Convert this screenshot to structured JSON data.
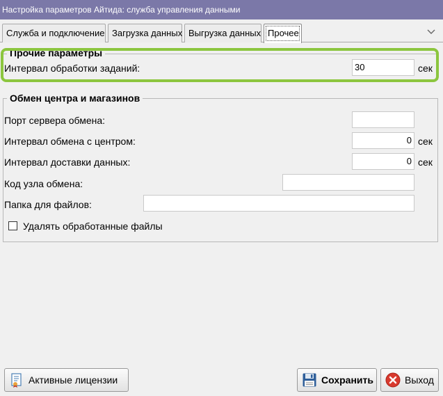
{
  "window": {
    "title": "Настройка параметров Айтида: служба управления данными"
  },
  "tabs": [
    {
      "label": "Служба и подключение",
      "active": false
    },
    {
      "label": "Загрузка данных",
      "active": false
    },
    {
      "label": "Выгрузка данных",
      "active": false
    },
    {
      "label": "Прочее",
      "active": true
    }
  ],
  "other_params": {
    "title": "Прочие параметры",
    "task_interval_label": "Интервал обработки заданий:",
    "task_interval_value": "30",
    "task_interval_unit": "сек"
  },
  "exchange": {
    "title": "Обмен центра и магазинов",
    "server_port_label": "Порт сервера обмена:",
    "server_port_value": "",
    "center_interval_label": "Интервал обмена с центром:",
    "center_interval_value": "0",
    "center_interval_unit": "сек",
    "delivery_interval_label": "Интервал доставки данных:",
    "delivery_interval_value": "0",
    "delivery_interval_unit": "сек",
    "node_code_label": "Код узла обмена:",
    "node_code_value": "",
    "folder_label": "Папка для файлов:",
    "folder_value": "",
    "delete_files_label": "Удалять обработанные файлы",
    "delete_files_checked": false
  },
  "footer": {
    "licenses_label": "Активные лицензии",
    "save_label": "Сохранить",
    "exit_label": "Выход"
  },
  "colors": {
    "titlebar": "#7b78a8",
    "highlight": "#8cc63f"
  }
}
